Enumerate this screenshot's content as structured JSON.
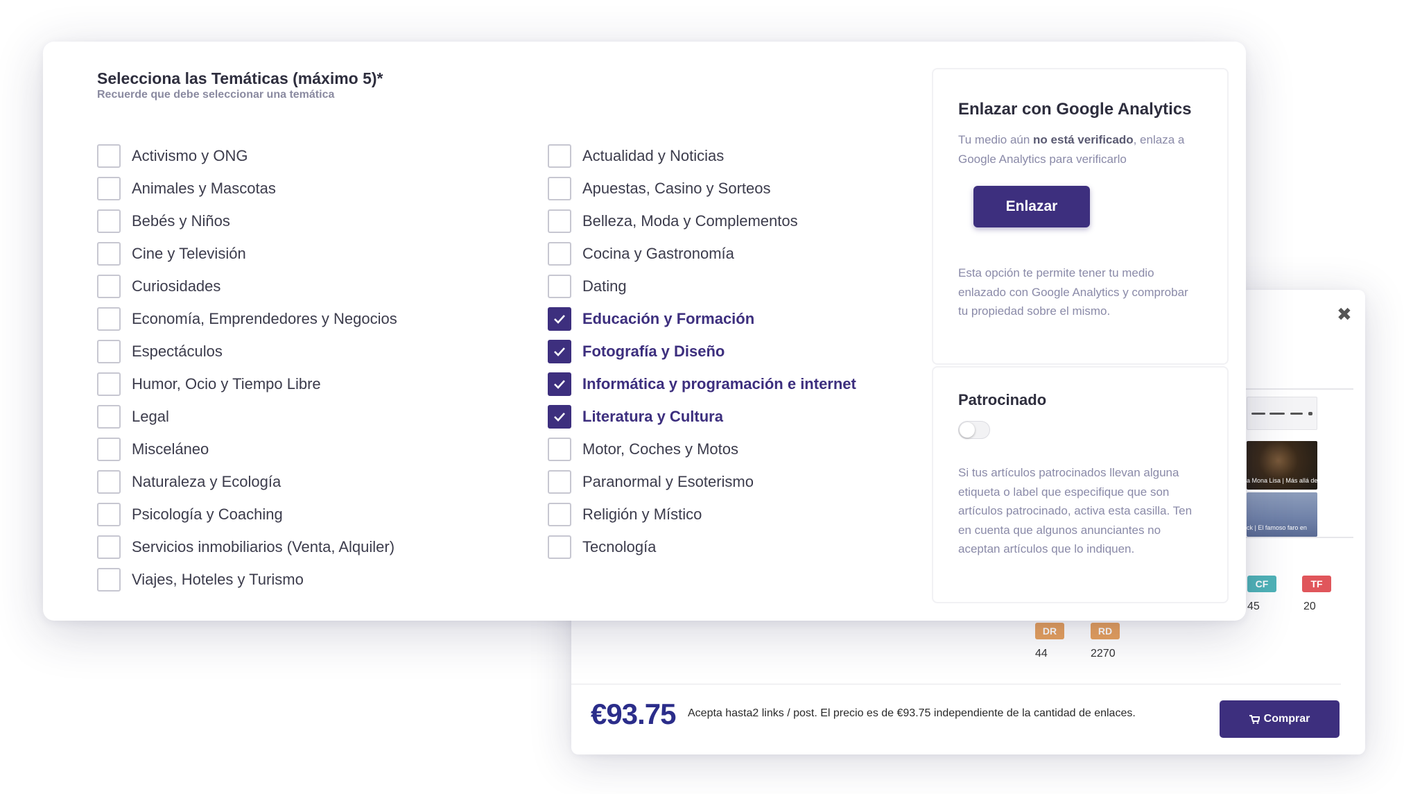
{
  "topics_section": {
    "title": "Selecciona las Temáticas (máximo 5)*",
    "subtitle": "Recuerde que debe seleccionar una temática",
    "left_column": [
      {
        "label": "Activismo y ONG",
        "checked": false
      },
      {
        "label": "Animales y Mascotas",
        "checked": false
      },
      {
        "label": "Bebés y Niños",
        "checked": false
      },
      {
        "label": "Cine y Televisión",
        "checked": false
      },
      {
        "label": "Curiosidades",
        "checked": false
      },
      {
        "label": "Economía, Emprendedores y Negocios",
        "checked": false
      },
      {
        "label": "Espectáculos",
        "checked": false
      },
      {
        "label": "Humor, Ocio y Tiempo Libre",
        "checked": false
      },
      {
        "label": "Legal",
        "checked": false
      },
      {
        "label": "Misceláneo",
        "checked": false
      },
      {
        "label": "Naturaleza y Ecología",
        "checked": false
      },
      {
        "label": "Psicología y Coaching",
        "checked": false
      },
      {
        "label": "Servicios inmobiliarios (Venta, Alquiler)",
        "checked": false
      },
      {
        "label": "Viajes, Hoteles y Turismo",
        "checked": false
      }
    ],
    "right_column": [
      {
        "label": "Actualidad y Noticias",
        "checked": false
      },
      {
        "label": "Apuestas, Casino y Sorteos",
        "checked": false
      },
      {
        "label": "Belleza, Moda y Complementos",
        "checked": false
      },
      {
        "label": "Cocina y Gastronomía",
        "checked": false
      },
      {
        "label": "Dating",
        "checked": false
      },
      {
        "label": "Educación y Formación",
        "checked": true
      },
      {
        "label": "Fotografía y Diseño",
        "checked": true
      },
      {
        "label": "Informática y programación e internet",
        "checked": true
      },
      {
        "label": "Literatura y Cultura",
        "checked": true
      },
      {
        "label": "Motor, Coches y Motos",
        "checked": false
      },
      {
        "label": "Paranormal y Esoterismo",
        "checked": false
      },
      {
        "label": "Religión y Místico",
        "checked": false
      },
      {
        "label": "Tecnología",
        "checked": false
      }
    ]
  },
  "analytics_panel": {
    "title": "Enlazar con Google Analytics",
    "status_prefix": "Tu medio aún ",
    "status_bold": "no está verificado",
    "status_suffix": ", enlaza a Google Analytics para verificarlo",
    "button_label": "Enlazar",
    "info": "Esta opción te permite tener tu medio enlazado con Google Analytics y comprobar tu propiedad sobre el mismo."
  },
  "sponsored_panel": {
    "title": "Patrocinado",
    "toggle_on": false,
    "info": "Si tus artículos patrocinados llevan alguna etiqueta o label que especifique que son artículos patrocinado, activa esta casilla. Ten en cuenta que algunos anunciantes no aceptan artículos que lo indiquen."
  },
  "product_modal": {
    "close_icon": "close-icon",
    "thumb_captions": [
      "a Mona Lisa | Más allá de",
      "ck | El famoso faro en"
    ],
    "metrics": [
      {
        "label": "CF",
        "value": "45",
        "color": "#4fb3b8"
      },
      {
        "label": "TF",
        "value": "20",
        "color": "#e0565b"
      },
      {
        "label": "DR",
        "value": "44",
        "color": "#e7a15e"
      },
      {
        "label": "RD",
        "value": "2270",
        "color": "#e7a15e"
      }
    ],
    "price": "€93.75",
    "price_note": "Acepta hasta2 links / post. El precio es de €93.75 independiente de la cantidad de enlaces.",
    "buy_label": "Comprar",
    "buy_icon": "cart-icon",
    "accent_color": "#3d2f7e"
  }
}
